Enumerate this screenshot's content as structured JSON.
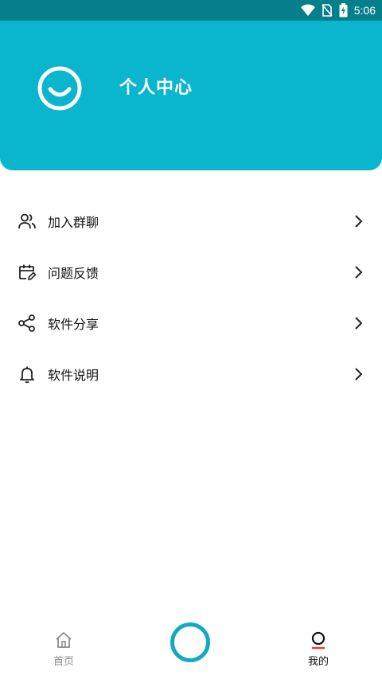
{
  "status_bar": {
    "time": "5:06"
  },
  "header": {
    "title": "个人中心"
  },
  "menu": {
    "items": [
      {
        "label": "加入群聊",
        "icon": "users-icon"
      },
      {
        "label": "问题反馈",
        "icon": "calendar-edit-icon"
      },
      {
        "label": "软件分享",
        "icon": "share-icon"
      },
      {
        "label": "软件说明",
        "icon": "bell-icon"
      }
    ]
  },
  "tabbar": {
    "home_label": "首页",
    "mine_label": "我的"
  },
  "colors": {
    "header_bg": "#0ab5ce",
    "status_bg": "#067f8c",
    "accent_ring": "#13a9c0",
    "active_indicator": "#e53935"
  }
}
